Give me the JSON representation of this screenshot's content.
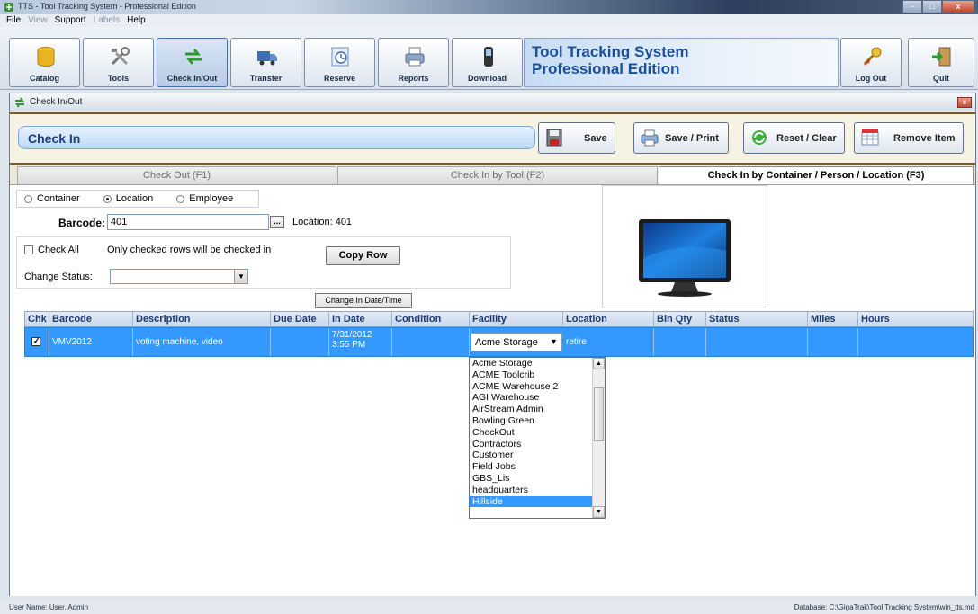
{
  "window": {
    "title": "TTS - Tool Tracking System - Professional Edition"
  },
  "menu": [
    "File",
    "View",
    "Support",
    "Labels",
    "Help"
  ],
  "toolbar": {
    "buttons": [
      "Catalog",
      "Tools",
      "Check In/Out",
      "Transfer",
      "Reserve",
      "Reports",
      "Download"
    ],
    "brand_line1": "Tool Tracking System",
    "brand_line2": "Professional Edition",
    "logout": "Log Out",
    "quit": "Quit"
  },
  "child": {
    "title": "Check In/Out",
    "header": "Check In",
    "save": "Save",
    "save_print": "Save / Print",
    "reset": "Reset / Clear",
    "remove": "Remove Item"
  },
  "tabs": [
    "Check Out (F1)",
    "Check In by Tool (F2)",
    "Check In by Container / Person / Location (F3)"
  ],
  "filters": {
    "radio_container": "Container",
    "radio_location": "Location",
    "radio_employee": "Employee",
    "selected_radio": "Location",
    "barcode_label": "Barcode:",
    "barcode_value": "401",
    "ellipsis": "...",
    "location_label": "Location:  401",
    "check_all": "Check All",
    "only_checked": "Only checked rows will be checked in",
    "copy_row": "Copy Row",
    "change_status": "Change Status:",
    "change_datetime": "Change In Date/Time"
  },
  "grid": {
    "columns": [
      "Chk",
      "Barcode",
      "Description",
      "Due Date",
      "In Date",
      "Condition",
      "Facility",
      "Location",
      "Bin Qty",
      "Status",
      "Miles",
      "Hours"
    ],
    "row": {
      "checked": true,
      "barcode": "VMV2012",
      "description": "voting machine, video",
      "due_date": "",
      "in_date_line1": "7/31/2012",
      "in_date_line2": "3:55 PM",
      "condition": "",
      "facility": "Acme Storage",
      "location": "retire"
    }
  },
  "facility_options": [
    "Acme Storage",
    "ACME Toolcrib",
    "ACME Warehouse 2",
    "AGI Warehouse",
    "AirStream Admin",
    "Bowling Green",
    "CheckOut",
    "Contractors",
    "Customer",
    "Field Jobs",
    "GBS_Lis",
    "headquarters",
    "Hillside"
  ],
  "facility_highlighted": "Hillside",
  "statusbar": {
    "left": "User Name:  User, Admin",
    "right": "Database:  C:\\GigaTrak\\Tool Tracking System\\win_tts.md"
  },
  "colors": {
    "selection": "#3399ff",
    "brand_text": "#1b4f9b",
    "frame_brown": "#7a5a2a"
  }
}
